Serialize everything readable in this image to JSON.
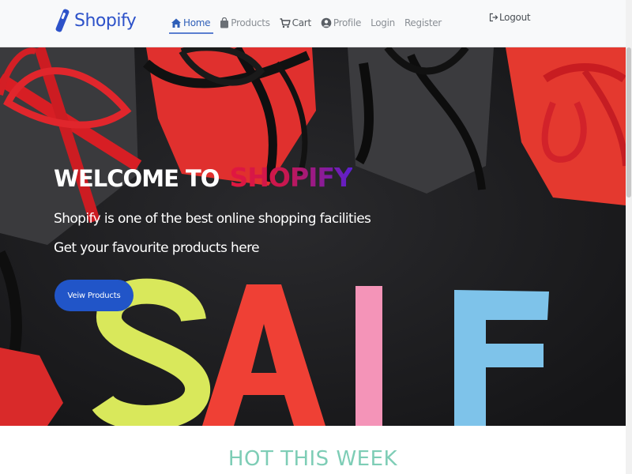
{
  "app": {
    "brand_name": "Shopify",
    "brand_color": "#2d52c9"
  },
  "nav": {
    "items": [
      {
        "label": "Home",
        "icon": "home-icon",
        "active": true
      },
      {
        "label": "Products",
        "icon": "shopping-bag-icon"
      },
      {
        "label": "Cart",
        "icon": "cart-icon"
      },
      {
        "label": "Profile",
        "icon": "user-circle-icon"
      },
      {
        "label": "Login"
      },
      {
        "label": "Register"
      }
    ],
    "logout_label": "Logout",
    "logout_icon": "logout-icon"
  },
  "hero": {
    "title_prefix": "WELCOME TO",
    "title_brand": "SHOPIFY",
    "line1": "Shopify is one of the best online shopping facilities",
    "line2": "Get your favourite products here",
    "button_label": "Veiw Products",
    "banner_text": "SALE",
    "banner_colors": [
      "#d9e85b",
      "#ef4035",
      "#f494b8",
      "#7ec3ea"
    ]
  },
  "section": {
    "title": "HOT THIS WEEK",
    "title_color": "#7ecdb6"
  }
}
